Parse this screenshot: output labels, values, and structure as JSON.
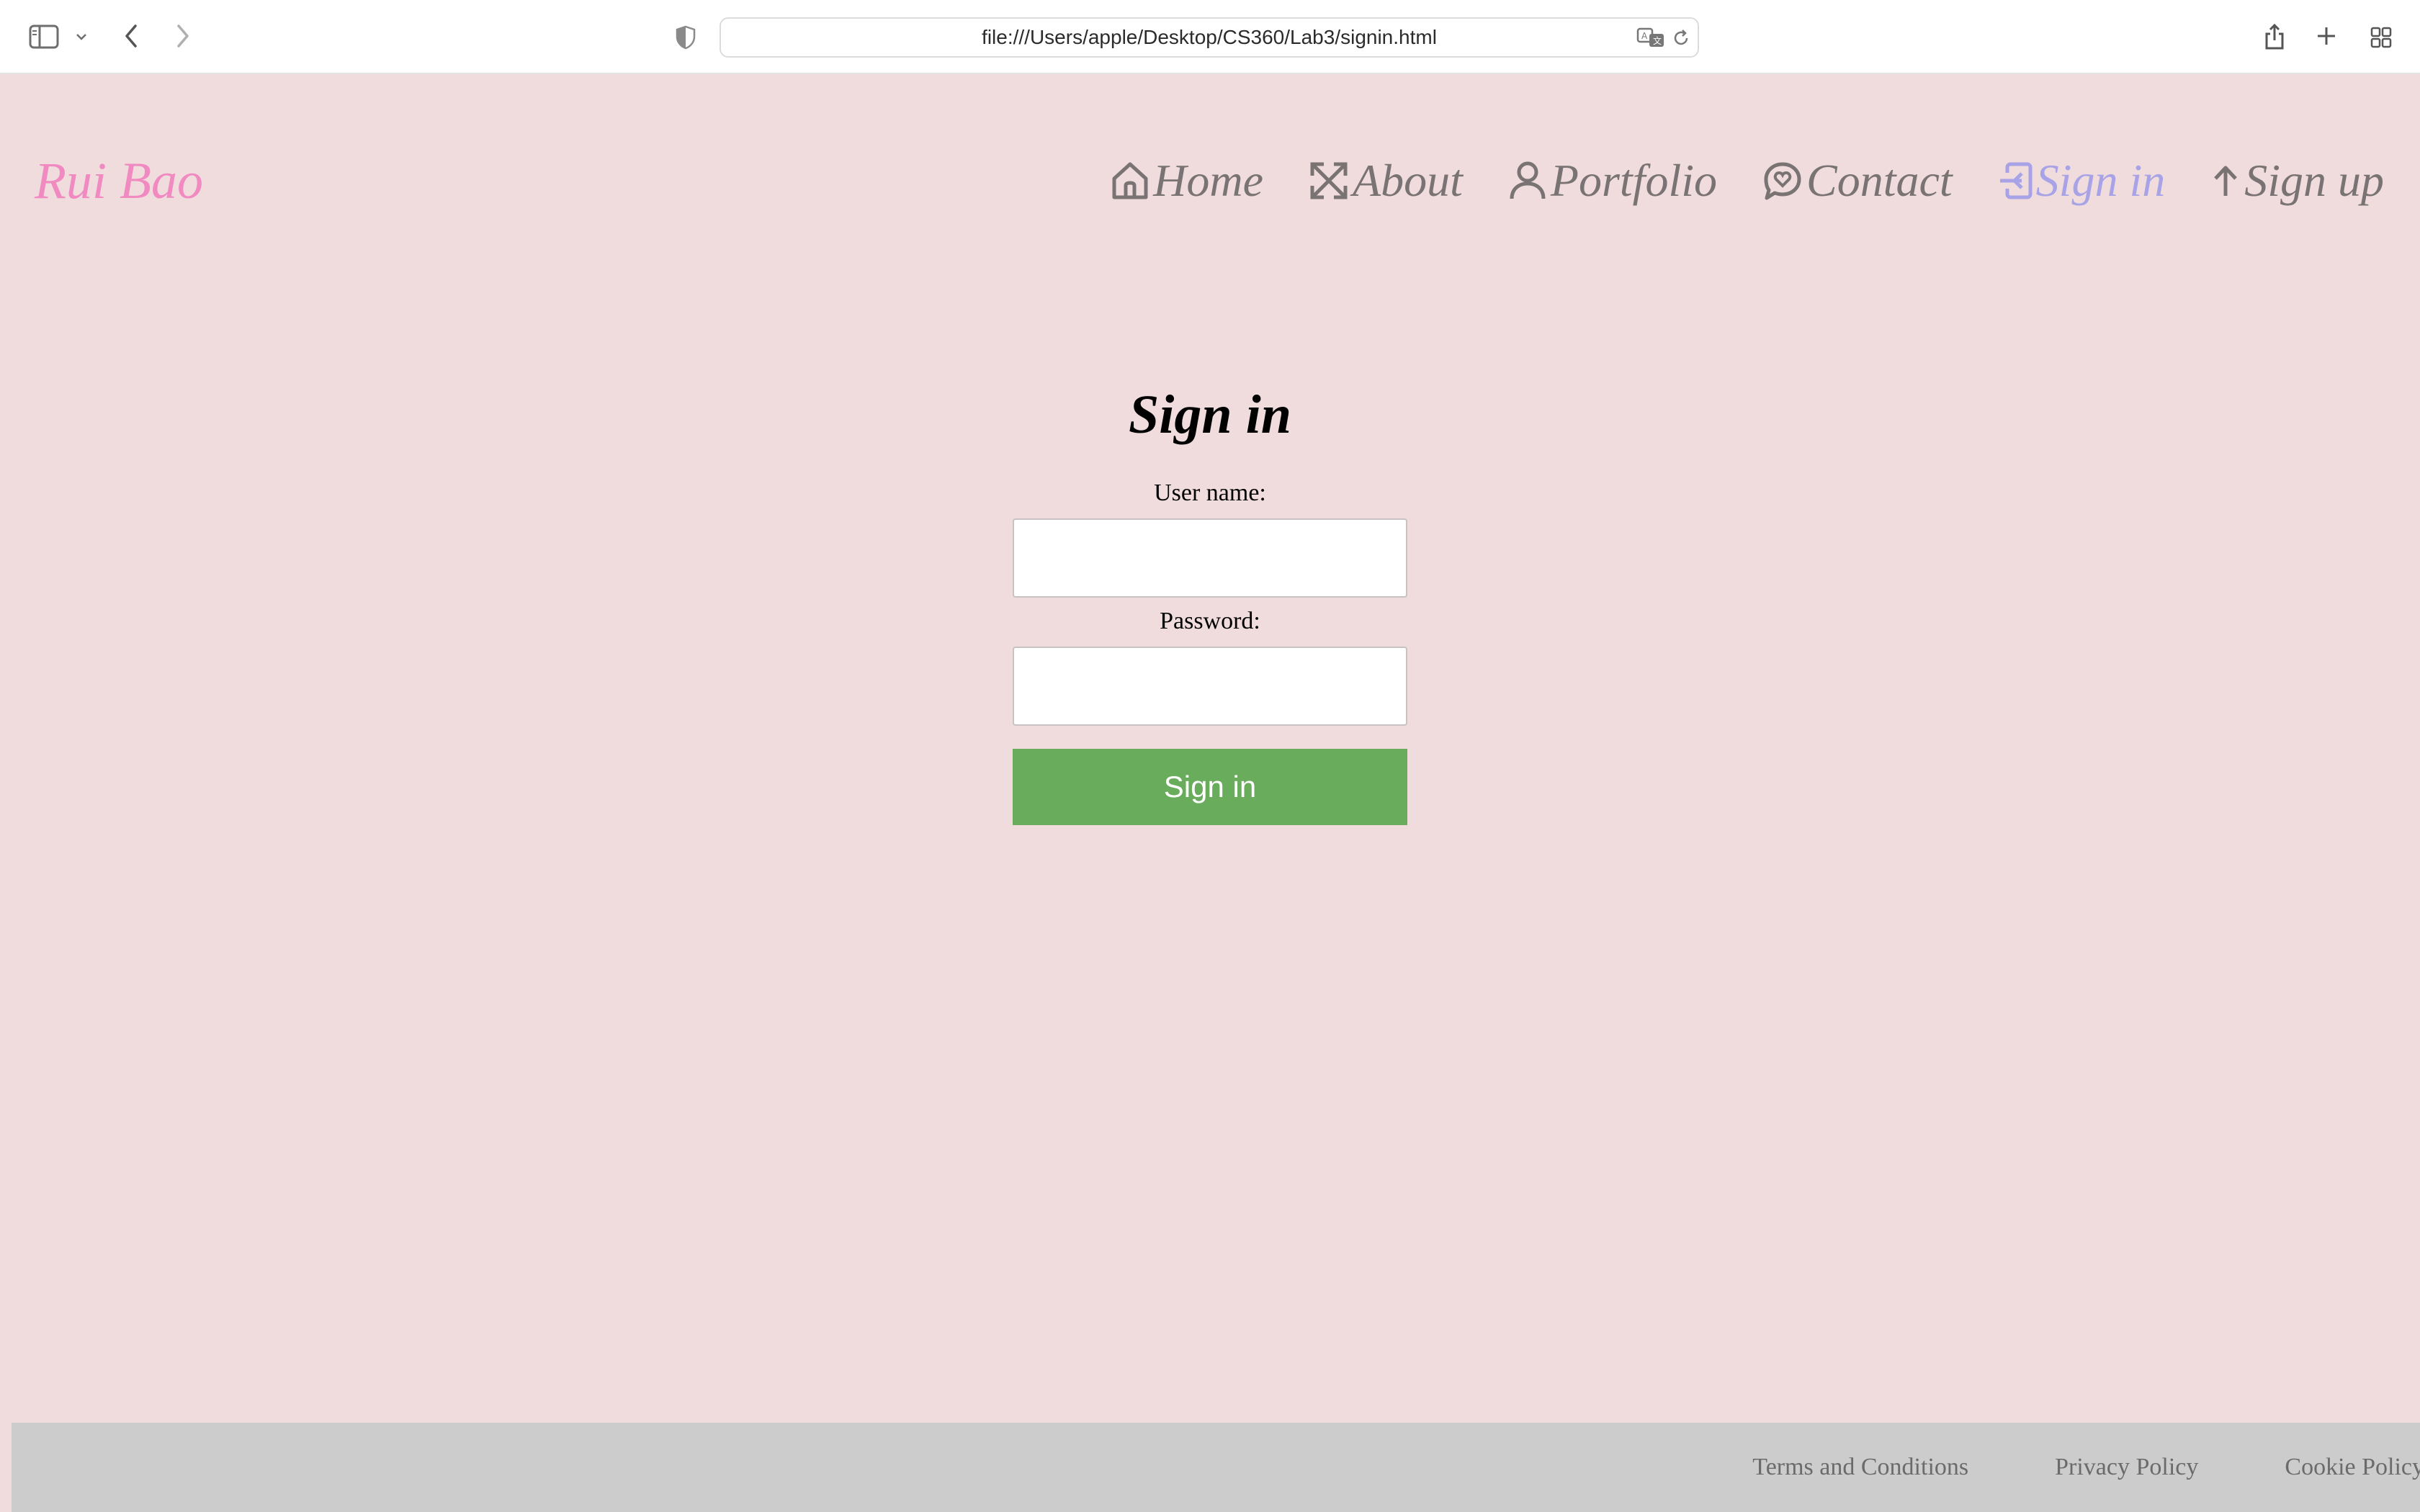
{
  "browser": {
    "url": "file:///Users/apple/Desktop/CS360/Lab3/signin.html",
    "icons": [
      "sidebar-icon",
      "chevron-down-icon",
      "back-icon",
      "forward-icon",
      "shield-icon",
      "translate-icon",
      "reload-icon",
      "share-icon",
      "new-tab-icon",
      "tab-overview-icon"
    ]
  },
  "site": {
    "logo": "Rui Bao",
    "logo_color": "#f08ac0",
    "nav": [
      {
        "label": "Home",
        "icon": "home-icon"
      },
      {
        "label": "About",
        "icon": "expand-icon"
      },
      {
        "label": "Portfolio",
        "icon": "person-icon"
      },
      {
        "label": "Contact",
        "icon": "chat-heart-icon"
      },
      {
        "label": "Sign in",
        "icon": "sign-in-icon",
        "active": true
      },
      {
        "label": "Sign up",
        "icon": "arrow-up-icon"
      }
    ],
    "active_color": "#a7a3e6"
  },
  "form": {
    "title": "Sign in",
    "username_label": "User name:",
    "username_value": "",
    "password_label": "Password:",
    "password_value": "",
    "submit_label": "Sign in",
    "submit_color": "#69ad5c"
  },
  "footer": {
    "links": [
      "Terms and Conditions",
      "Privacy Policy",
      "Cookie Policy"
    ]
  }
}
